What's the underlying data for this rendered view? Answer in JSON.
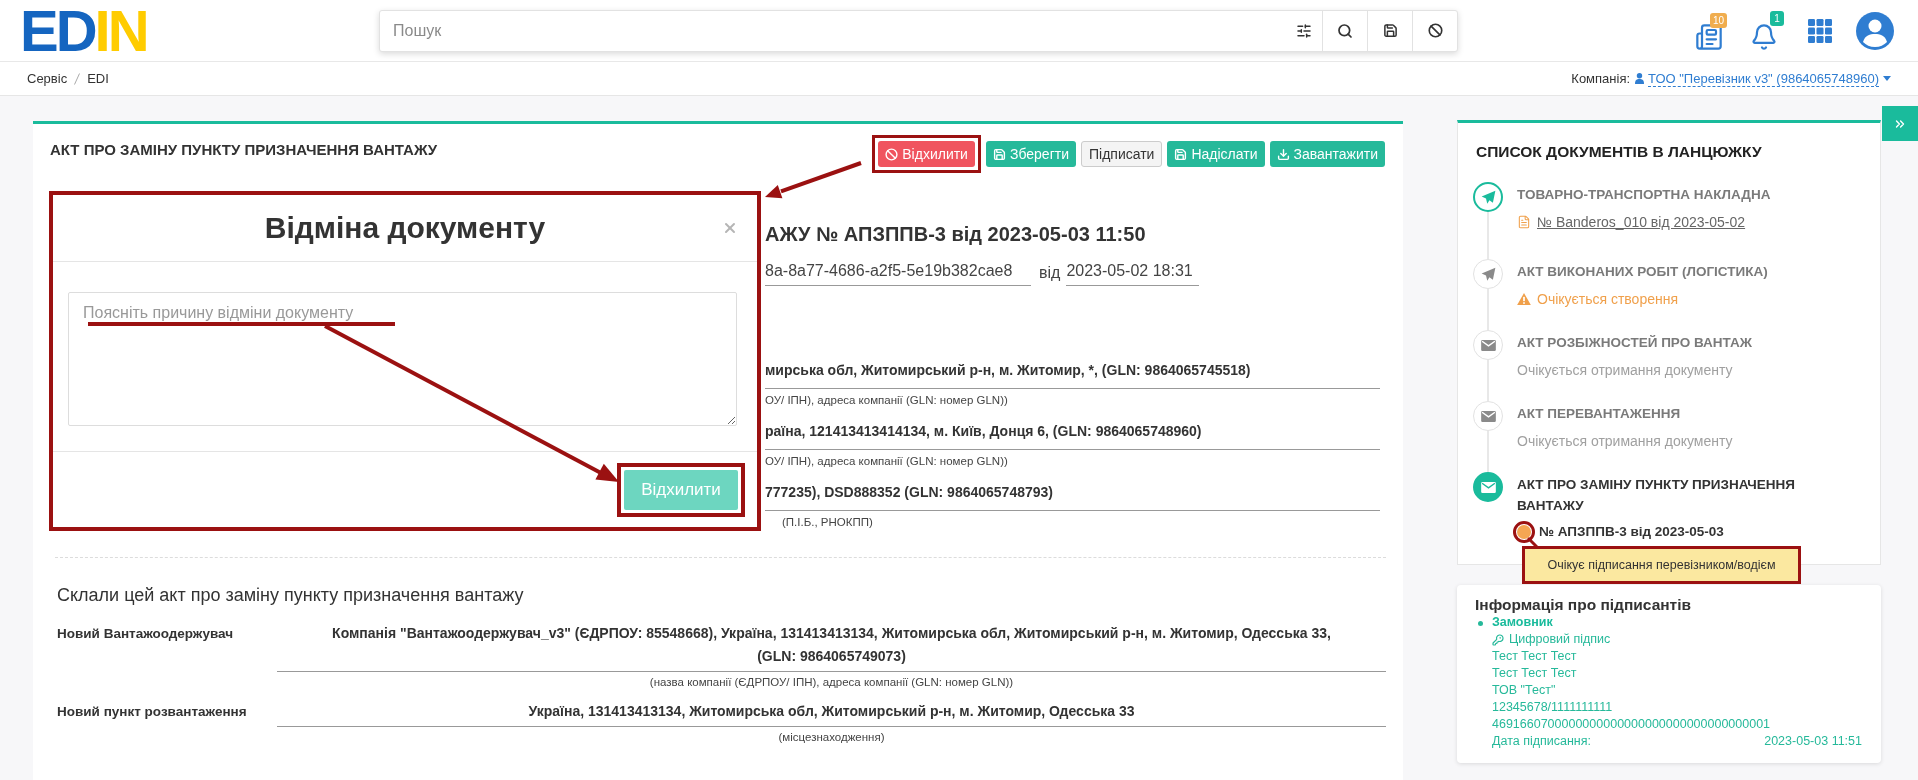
{
  "header": {
    "logo": [
      "ED",
      "IN"
    ],
    "search_placeholder": "Пошук",
    "indicators": [
      {
        "kind": "news",
        "badge": "10",
        "color": "#f0ad4e"
      },
      {
        "kind": "alerts",
        "badge": "1",
        "color": "#1abb9c"
      }
    ]
  },
  "breadcrumbs": [
    "Сервіс",
    "EDI"
  ],
  "company": {
    "label": "Компанія:",
    "name": "ТОО \"Перевізник v3\" (9864065748960)"
  },
  "document": {
    "title": "АКТ ПРО ЗАМІНУ ПУНКТУ ПРИЗНАЧЕННЯ ВАНТАЖУ",
    "actions": [
      {
        "kind": "reject",
        "label": "Відхилити",
        "highlighted": true
      },
      {
        "kind": "save",
        "label": "Зберегти",
        "highlighted": false
      },
      {
        "kind": "sign",
        "label": "Підписати",
        "highlighted": false
      },
      {
        "kind": "send",
        "label": "Надіслати",
        "highlighted": false
      },
      {
        "kind": "download",
        "label": "Завантажити",
        "highlighted": false
      }
    ],
    "dialog": {
      "title": "Відміна документу",
      "placeholder": "Поясніть причину відміни документу",
      "placeholder_marked": true,
      "button": {
        "label": "Відхилити",
        "highlighted": true
      }
    },
    "heading": "АЖУ № АПЗППВ-3 від 2023-05-03 11:50",
    "reference": {
      "number": "8a-8a77-4686-a2f5-5e19b382cae8",
      "joiner": "від",
      "date": "2023-05-02 18:31"
    },
    "parties": [
      {
        "value": "мирська обл, Житомирський р-н, м. Житомир, *, (GLN: 9864065745518)",
        "caption": "ОУ/ ІПН), адреса компанії (GLN: номер GLN))"
      },
      {
        "value": "раїна, 121413413414134, м. Київ, Донця 6, (GLN: 9864065748960)",
        "caption": "ОУ/ ІПН), адреса компанії (GLN: номер GLN))"
      },
      {
        "value": "777235), DSD888352 (GLN: 9864065748793)",
        "caption": "(П.І.Б., РНОКПП)"
      }
    ],
    "section_title": "Склали цей акт про заміну пункту призначення вантажу",
    "fields": [
      {
        "label": "Новий Вантажоодержувач",
        "value": "Компанія \"Вантажоодержувач_v3\" (ЄДРПОУ: 85548668), Україна, 131413413134, Житомирська обл, Житомирський р-н, м. Житомир, Одесська 33, (GLN: 9864065749073)",
        "caption": "(назва компанії (ЄДРПОУ/ ІПН), адреса компанії (GLN: номер GLN))"
      },
      {
        "label": "Новий пункт розвантаження",
        "value": "Україна, 131413413134, Житомирська обл, Житомирський р-н, м. Житомир, Одесська 33",
        "caption": "(місцезнаходження)"
      }
    ]
  },
  "chain": {
    "title": "СПИСОК ДОКУМЕНТІВ В ЛАНЦЮЖКУ",
    "items": [
      {
        "title": "ТОВАРНО-ТРАНСПОРТНА НАКЛАДНА",
        "kind": "send",
        "done": true,
        "selected": false,
        "note": {
          "kind": "link",
          "text": "№ Banderos_010 від 2023-05-02"
        }
      },
      {
        "title": "АКТ ВИКОНАНИХ РОБІТ (ЛОГІСТИКА)",
        "kind": "send",
        "done": false,
        "selected": false,
        "note": {
          "kind": "warning",
          "text": "Очікується створення"
        }
      },
      {
        "title": "АКТ РОЗБІЖНОСТЕЙ ПРО ВАНТАЖ",
        "kind": "mail",
        "done": false,
        "selected": false,
        "note": {
          "kind": "muted",
          "text": "Очікується отримання документу"
        }
      },
      {
        "title": "АКТ ПЕРЕВАНТАЖЕННЯ",
        "kind": "mail",
        "done": false,
        "selected": false,
        "note": {
          "kind": "muted",
          "text": "Очікується отримання документу"
        }
      },
      {
        "title": "АКТ ПРО ЗАМІНУ ПУНКТУ ПРИЗНАЧЕННЯ ВАНТАЖУ",
        "kind": "mail",
        "done": true,
        "selected": true,
        "note": {
          "kind": "number",
          "text": "№ АПЗППВ-3 від 2023-05-03",
          "color": "#f5a653",
          "highlighted": true,
          "tooltip": "Очікує підписання перевізником/водієм"
        }
      }
    ]
  },
  "signers": {
    "title": "Інформація про підписантів",
    "entries": [
      {
        "role": "Замовник",
        "signature": "Цифровий підпис",
        "lines": [
          "Тест Тест Тест",
          "Тест Тест Тест",
          "ТОВ \"Тест\"",
          "12345678/1111111111",
          "4691660700000000000000000000000000000001"
        ],
        "date_label": "Дата підписання:",
        "date": "2023-05-03 11:51"
      }
    ]
  }
}
